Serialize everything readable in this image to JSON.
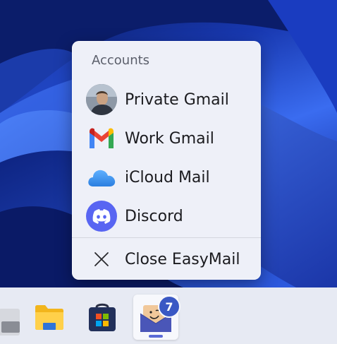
{
  "menu": {
    "header": "Accounts",
    "items": [
      {
        "label": "Private Gmail",
        "icon": "avatar"
      },
      {
        "label": "Work Gmail",
        "icon": "gmail-icon"
      },
      {
        "label": "iCloud Mail",
        "icon": "icloud-icon"
      },
      {
        "label": "Discord",
        "icon": "discord-icon"
      }
    ],
    "close_label": "Close EasyMail"
  },
  "taskbar": {
    "items": [
      {
        "name": "file-explorer-icon"
      },
      {
        "name": "microsoft-store-icon"
      },
      {
        "name": "easymail-icon"
      }
    ],
    "badge_count": "7"
  },
  "colors": {
    "accent": "#3a58c4",
    "menu_bg": "#eef0f8",
    "taskbar_bg": "#e7eaf3"
  }
}
